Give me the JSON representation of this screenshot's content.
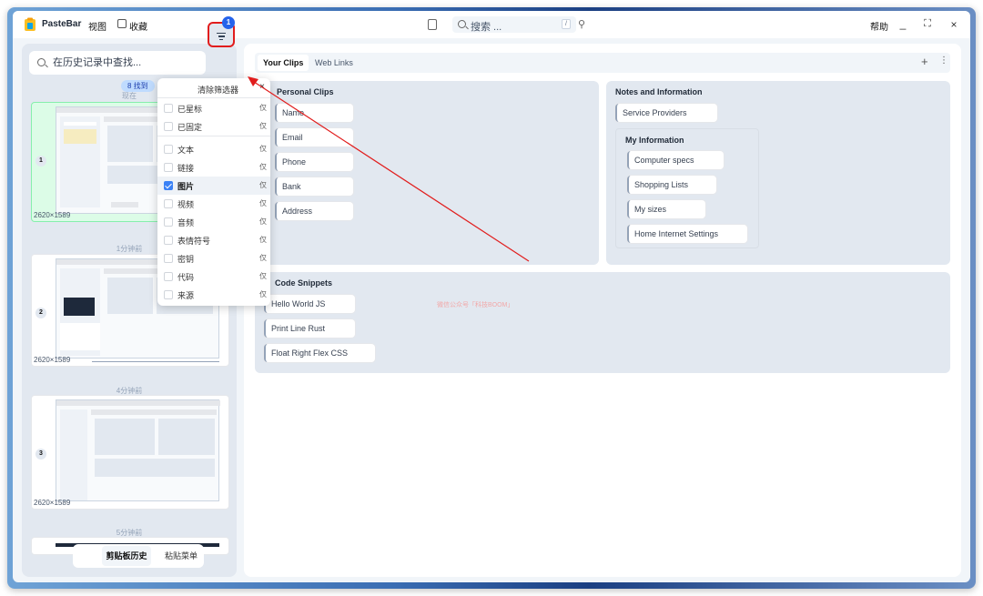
{
  "titlebar": {
    "app_name": "PasteBar",
    "menu_view": "视图",
    "menu_collections": "收藏",
    "search_placeholder": "搜索 ...",
    "search_key": "/",
    "help": "帮助",
    "min": "_",
    "max": "[ ]",
    "close": "×"
  },
  "history": {
    "search_placeholder": "在历史记录中查找...",
    "filter_badge": "1",
    "found_text": "8 找到",
    "clips": [
      {
        "time": "现在",
        "num": "1",
        "size": "2620×1589"
      },
      {
        "time": "1分钟前",
        "num": "2",
        "size": "2620×1589"
      },
      {
        "time": "4分钟前",
        "num": "3",
        "size": "2620×1589"
      },
      {
        "time": "5分钟前",
        "num": "",
        "size": ""
      }
    ],
    "bottom_tabs": [
      "剪贴板历史",
      "粘贴菜单"
    ]
  },
  "filter_menu": {
    "clear": "清除筛选器",
    "close": "×",
    "only_label": "仅",
    "items": [
      {
        "label": "已星标",
        "checked": false
      },
      {
        "label": "已固定",
        "checked": false
      },
      {
        "label": "文本",
        "checked": false
      },
      {
        "label": "链接",
        "checked": false
      },
      {
        "label": "图片",
        "checked": true
      },
      {
        "label": "视频",
        "checked": false
      },
      {
        "label": "音频",
        "checked": false
      },
      {
        "label": "表情符号",
        "checked": false
      },
      {
        "label": "密钥",
        "checked": false
      },
      {
        "label": "代码",
        "checked": false
      },
      {
        "label": "来源",
        "checked": false
      }
    ]
  },
  "clips_panel": {
    "tabs": [
      "Your Clips",
      "Web Links"
    ],
    "plus": "+",
    "more": "⋮",
    "boards": {
      "personal": {
        "title": "Personal Clips",
        "clips": [
          "Name",
          "Email",
          "Phone",
          "Bank",
          "Address"
        ]
      },
      "notes": {
        "title": "Notes and Information",
        "clips": [
          "Service Providers"
        ],
        "sub": {
          "title": "My Information",
          "clips": [
            "Computer specs",
            "Shopping Lists",
            "My sizes",
            "Home Internet Settings"
          ]
        }
      },
      "code": {
        "title": "Code Snippets",
        "clips": [
          "Hello World JS",
          "Print Line Rust",
          "Float Right Flex CSS"
        ]
      }
    },
    "watermark": "微信公众号「科技BOOM」"
  },
  "colors": {
    "accent": "#2563eb",
    "highlight": "#e11d1d",
    "selected_clip": "#dcfce7"
  }
}
